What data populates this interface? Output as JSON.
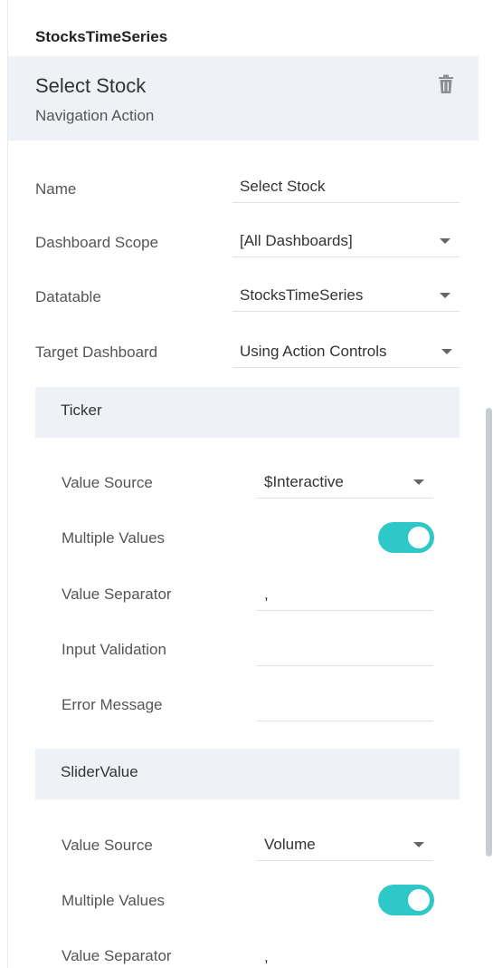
{
  "panel": {
    "datasource_title": "StocksTimeSeries"
  },
  "action": {
    "name": "Select Stock",
    "type": "Navigation Action",
    "delete_icon": "trash-icon"
  },
  "form": {
    "name_label": "Name",
    "name_value": "Select Stock",
    "scope_label": "Dashboard Scope",
    "scope_value": "[All Dashboards]",
    "datatable_label": "Datatable",
    "datatable_value": "StocksTimeSeries",
    "target_label": "Target Dashboard",
    "target_value": "Using Action Controls"
  },
  "parameters": [
    {
      "title": "Ticker",
      "value_source_label": "Value Source",
      "value_source": "$Interactive",
      "multiple_values_label": "Multiple Values",
      "multiple_values": true,
      "separator_label": "Value Separator",
      "separator": ",",
      "validation_label": "Input Validation",
      "validation": "",
      "error_label": "Error Message",
      "error": ""
    },
    {
      "title": "SliderValue",
      "value_source_label": "Value Source",
      "value_source": "Volume",
      "multiple_values_label": "Multiple Values",
      "multiple_values": true,
      "separator_label": "Value Separator",
      "separator": ","
    }
  ],
  "colors": {
    "toggle_on": "#2ec8c8",
    "header_bg": "#eef1f5"
  }
}
